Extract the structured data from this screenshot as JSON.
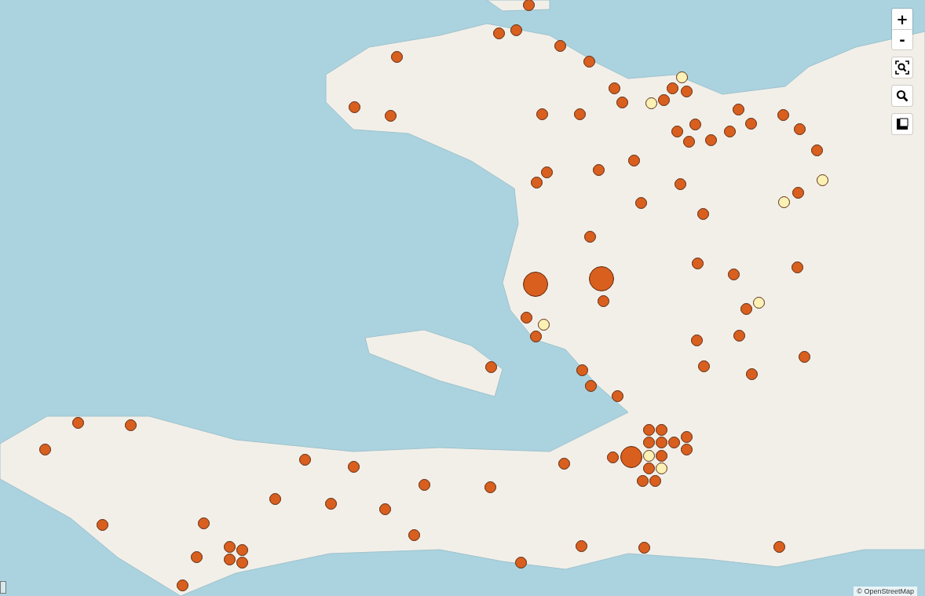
{
  "map": {
    "zoom_buttons": [
      {
        "label": "+"
      },
      {
        "label": "-"
      }
    ],
    "attribution": "© OpenStreetMap",
    "markers": [
      {
        "color": "#d95f1f",
        "kind": "small"
      },
      {
        "color": "#d95f1f",
        "kind": "small"
      },
      {
        "color": "#d95f1f",
        "kind": "small"
      },
      {
        "color": "#d95f1f",
        "kind": "small"
      },
      {
        "color": "#d95f1f",
        "kind": "small"
      },
      {
        "color": "#d95f1f",
        "kind": "small"
      },
      {
        "color": "#d95f1f",
        "kind": "small"
      },
      {
        "color": "#d95f1f",
        "kind": "small"
      },
      {
        "color": "#d95f1f",
        "kind": "small"
      },
      {
        "color": "#d95f1f",
        "kind": "small"
      },
      {
        "color": "#fbf1b4",
        "kind": "small"
      },
      {
        "color": "#fbf1b4",
        "kind": "small"
      },
      {
        "color": "#d95f1f",
        "kind": "small"
      },
      {
        "color": "#d95f1f",
        "kind": "small"
      },
      {
        "color": "#d95f1f",
        "kind": "small"
      },
      {
        "color": "#d95f1f",
        "kind": "small"
      },
      {
        "color": "#d95f1f",
        "kind": "small"
      },
      {
        "color": "#d95f1f",
        "kind": "small"
      },
      {
        "color": "#d95f1f",
        "kind": "small"
      },
      {
        "color": "#d95f1f",
        "kind": "small"
      },
      {
        "color": "#d95f1f",
        "kind": "small"
      },
      {
        "color": "#d95f1f",
        "kind": "small"
      },
      {
        "color": "#d95f1f",
        "kind": "small"
      },
      {
        "color": "#d95f1f",
        "kind": "small"
      },
      {
        "color": "#d95f1f",
        "kind": "small"
      },
      {
        "color": "#d95f1f",
        "kind": "small"
      },
      {
        "color": "#d95f1f",
        "kind": "small"
      },
      {
        "color": "#d95f1f",
        "kind": "small"
      },
      {
        "color": "#d95f1f",
        "kind": "small"
      },
      {
        "color": "#d95f1f",
        "kind": "small"
      },
      {
        "color": "#d95f1f",
        "kind": "small"
      },
      {
        "color": "#d95f1f",
        "kind": "small"
      },
      {
        "color": "#fbf1b4",
        "kind": "small"
      },
      {
        "color": "#fbf1b4",
        "kind": "small"
      },
      {
        "color": "#d95f1f",
        "kind": "small"
      },
      {
        "color": "#d95f1f",
        "kind": "small"
      },
      {
        "color": "#d95f1f",
        "kind": "small"
      },
      {
        "color": "#d95f1f",
        "kind": "small"
      },
      {
        "color": "#d95f1f",
        "kind": "small"
      },
      {
        "color": "#d95f1f",
        "kind": "small"
      },
      {
        "color": "#d95f1f",
        "kind": "small"
      },
      {
        "color": "#d95f1f",
        "kind": "large"
      },
      {
        "color": "#d95f1f",
        "kind": "large"
      },
      {
        "color": "#d95f1f",
        "kind": "small"
      },
      {
        "color": "#d95f1f",
        "kind": "small"
      },
      {
        "color": "#fbf1b4",
        "kind": "small"
      },
      {
        "color": "#d95f1f",
        "kind": "small"
      },
      {
        "color": "#fbf1b4",
        "kind": "small"
      },
      {
        "color": "#d95f1f",
        "kind": "small"
      },
      {
        "color": "#d95f1f",
        "kind": "small"
      },
      {
        "color": "#d95f1f",
        "kind": "small"
      },
      {
        "color": "#d95f1f",
        "kind": "small"
      },
      {
        "color": "#d95f1f",
        "kind": "small"
      },
      {
        "color": "#d95f1f",
        "kind": "small"
      },
      {
        "color": "#d95f1f",
        "kind": "small"
      },
      {
        "color": "#d95f1f",
        "kind": "small"
      },
      {
        "color": "#d95f1f",
        "kind": "small"
      },
      {
        "color": "#d95f1f",
        "kind": "small"
      },
      {
        "color": "#d95f1f",
        "kind": "small"
      },
      {
        "color": "#d95f1f",
        "kind": "small"
      },
      {
        "color": "#d95f1f",
        "kind": "small"
      },
      {
        "color": "#d95f1f",
        "kind": "small"
      },
      {
        "color": "#d95f1f",
        "kind": "small"
      },
      {
        "color": "#d95f1f",
        "kind": "small"
      },
      {
        "color": "#d95f1f",
        "kind": "small"
      },
      {
        "color": "#d95f1f",
        "kind": "small"
      },
      {
        "color": "#d95f1f",
        "kind": "small"
      },
      {
        "color": "#d95f1f",
        "kind": "small"
      },
      {
        "color": "#d95f1f",
        "kind": "small"
      },
      {
        "color": "#d95f1f",
        "kind": "small"
      },
      {
        "color": "#d95f1f",
        "kind": "small"
      },
      {
        "color": "#d95f1f",
        "kind": "medium"
      },
      {
        "color": "#d95f1f",
        "kind": "small"
      },
      {
        "color": "#fbf1b4",
        "kind": "small"
      },
      {
        "color": "#fbf1b4",
        "kind": "small"
      },
      {
        "color": "#d95f1f",
        "kind": "small"
      },
      {
        "color": "#d95f1f",
        "kind": "small"
      },
      {
        "color": "#d95f1f",
        "kind": "small"
      },
      {
        "color": "#d95f1f",
        "kind": "small"
      },
      {
        "color": "#d95f1f",
        "kind": "small"
      },
      {
        "color": "#d95f1f",
        "kind": "small"
      },
      {
        "color": "#d95f1f",
        "kind": "small"
      },
      {
        "color": "#d95f1f",
        "kind": "small"
      },
      {
        "color": "#d95f1f",
        "kind": "small"
      },
      {
        "color": "#d95f1f",
        "kind": "small"
      },
      {
        "color": "#d95f1f",
        "kind": "small"
      },
      {
        "color": "#d95f1f",
        "kind": "small"
      },
      {
        "color": "#d95f1f",
        "kind": "small"
      },
      {
        "color": "#d95f1f",
        "kind": "small"
      },
      {
        "color": "#d95f1f",
        "kind": "small"
      },
      {
        "color": "#d95f1f",
        "kind": "small"
      },
      {
        "color": "#d95f1f",
        "kind": "small"
      },
      {
        "color": "#d95f1f",
        "kind": "small"
      },
      {
        "color": "#d95f1f",
        "kind": "small"
      },
      {
        "color": "#d95f1f",
        "kind": "small"
      },
      {
        "color": "#d95f1f",
        "kind": "small"
      },
      {
        "color": "#d95f1f",
        "kind": "small"
      }
    ]
  }
}
